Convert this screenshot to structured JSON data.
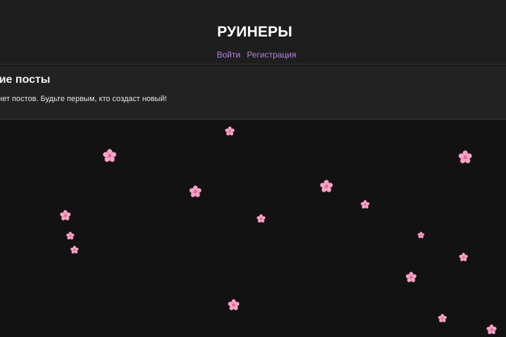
{
  "header": {
    "title": "РУИНЕРЫ",
    "nav": {
      "login_label": "Войти",
      "register_label": "Регистрация"
    }
  },
  "posts": {
    "heading": "едние посты",
    "empty_message": "о нет постов. Будьте первым, кто создаст новый!"
  },
  "decoration": {
    "icon": "sakura-flower-icon",
    "petal_color": "#f6a5c9",
    "center_color": "#d24a82",
    "count": 18
  },
  "theme": {
    "page_bg": "#131213",
    "header_bg": "#1e1e1e",
    "panel_bg": "#222222",
    "link_color": "#b583e6"
  }
}
